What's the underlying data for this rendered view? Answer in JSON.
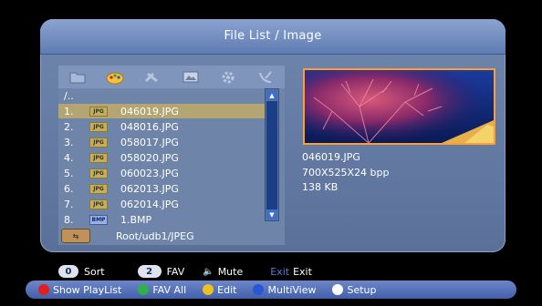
{
  "header": {
    "title": "File List / Image"
  },
  "toolbar": {
    "icons": [
      "folder-icon",
      "paint-palette-icon",
      "tools-icon",
      "image-icon",
      "gear-icon",
      "satellite-dish-icon"
    ]
  },
  "list": {
    "up_label": "/..",
    "items": [
      {
        "num": "1.",
        "type": "JPG",
        "name": "046019.JPG"
      },
      {
        "num": "2.",
        "type": "JPG",
        "name": "048016.JPG"
      },
      {
        "num": "3.",
        "type": "JPG",
        "name": "058017.JPG"
      },
      {
        "num": "4.",
        "type": "JPG",
        "name": "058020.JPG"
      },
      {
        "num": "5.",
        "type": "JPG",
        "name": "060023.JPG"
      },
      {
        "num": "6.",
        "type": "JPG",
        "name": "062013.JPG"
      },
      {
        "num": "7.",
        "type": "JPG",
        "name": "062014.JPG"
      },
      {
        "num": "8.",
        "type": "BMP",
        "name": "1.BMP"
      }
    ],
    "selected_index": 0
  },
  "path": "Root/udb1/JPEG",
  "info": {
    "filename": "046019.JPG",
    "resolution": "700X525X24 bpp",
    "size": "138 KB"
  },
  "hints": {
    "sort_key": "0",
    "sort_label": "Sort",
    "fav_key": "2",
    "fav_label": "FAV",
    "mute_label": "Mute",
    "exit_key": "Exit",
    "exit_label": "Exit"
  },
  "colorbar": {
    "red_label": "Show PlayList",
    "green_label": "FAV All",
    "yellow_label": "Edit",
    "blue_label": "MultiView",
    "white_label": "Setup"
  },
  "colors": {
    "accent_border": "#ff9d2f",
    "selection": "#b4a672",
    "red": "#e02020",
    "green": "#2fb04a",
    "yellow": "#f0c020",
    "blue": "#2a55d8",
    "white": "#ffffff"
  }
}
